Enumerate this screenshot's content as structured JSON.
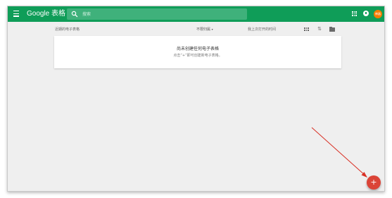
{
  "app": {
    "brand": "Google 表格",
    "search_placeholder": "搜索",
    "avatar_text": "神器"
  },
  "list": {
    "recent_label": "近期的电子表格",
    "owner_filter": "不限归属",
    "owner_caret": "▾",
    "last_opened_label": "我上次打开的时间"
  },
  "empty_state": {
    "title": "尚未创建任何电子表格",
    "hint": "点击“+”即可创建新电子表格。"
  },
  "fab": {
    "label": "+"
  },
  "colors": {
    "header": "#0f9d58",
    "fab": "#db4437",
    "annotation_arrow": "#d93025"
  }
}
